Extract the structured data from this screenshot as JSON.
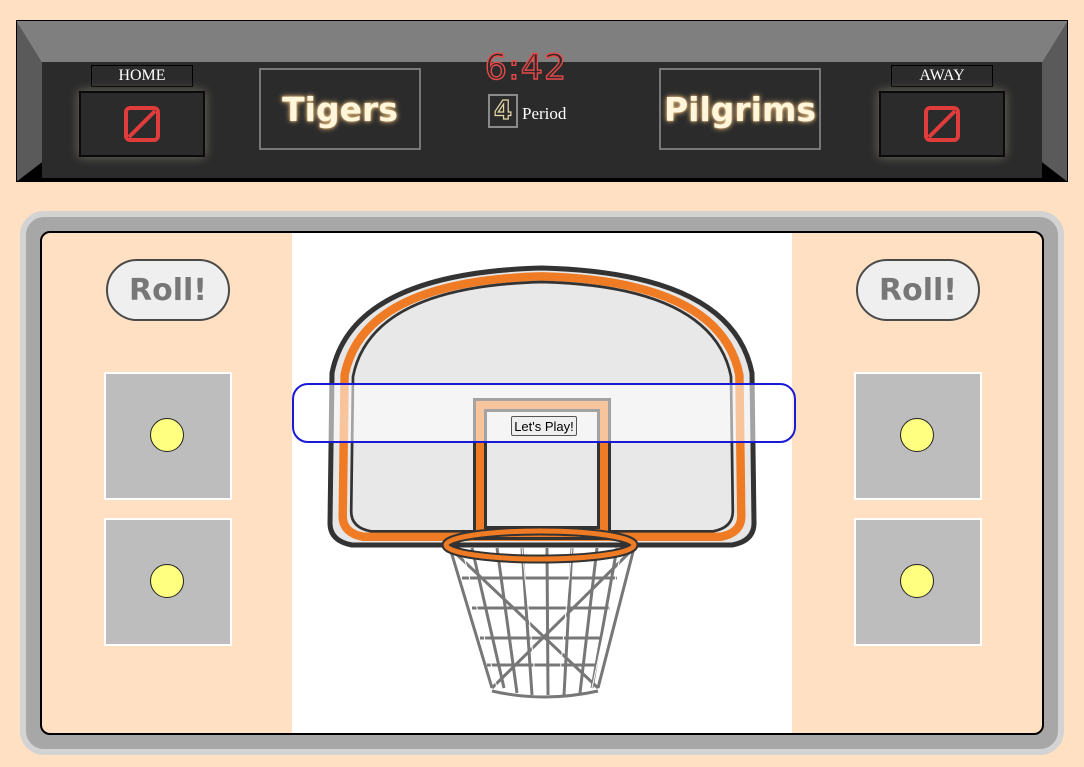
{
  "scoreboard": {
    "home": {
      "tag": "HOME",
      "team": "Tigers",
      "score": "0"
    },
    "away": {
      "tag": "AWAY",
      "team": "Pilgrims",
      "score": "0"
    },
    "clock": "6:42",
    "period": "4",
    "period_label": "Period"
  },
  "court": {
    "left_roll_label": "Roll!",
    "right_roll_label": "Roll!",
    "play_button_label": "Let's Play!",
    "dice_pip_color": "#ffff80",
    "dice_color": "#bdbdbd",
    "rim_color": "#ef7c24"
  }
}
